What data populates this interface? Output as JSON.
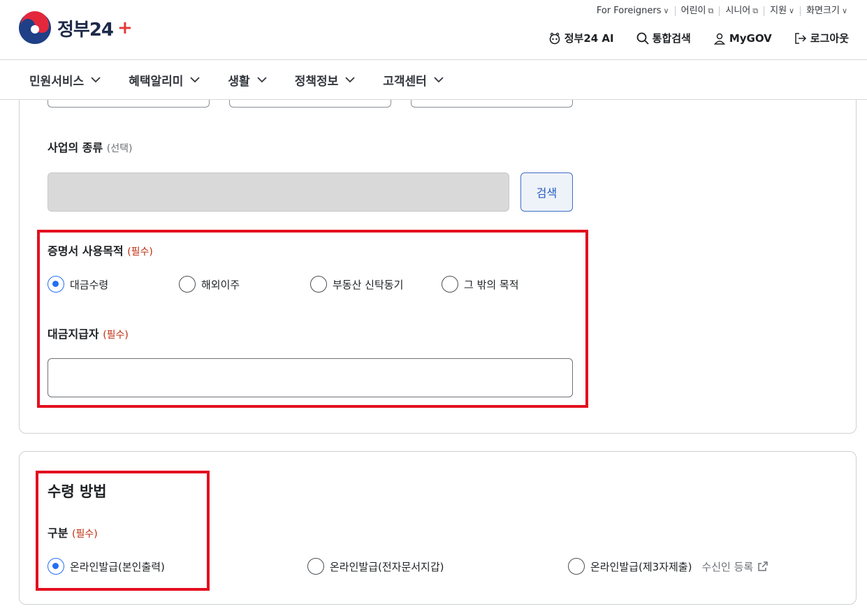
{
  "header": {
    "logo_text": "정부24",
    "logo_plus": "+",
    "util_links": [
      {
        "label": "For Foreigners",
        "glyph": "∨"
      },
      {
        "label": "어린이",
        "glyph": "⧉"
      },
      {
        "label": "시니어",
        "glyph": "⧉"
      },
      {
        "label": "지원",
        "glyph": "∨"
      },
      {
        "label": "화면크기",
        "glyph": "∨"
      }
    ],
    "main_links": [
      {
        "label": "정부24 AI",
        "icon": "ai-robot-icon"
      },
      {
        "label": "통합검색",
        "icon": "search-icon"
      },
      {
        "label": "MyGOV",
        "icon": "user-icon"
      },
      {
        "label": "로그아웃",
        "icon": "logout-icon"
      }
    ]
  },
  "gnb": {
    "items": [
      {
        "label": "민원서비스"
      },
      {
        "label": "혜택알리미"
      },
      {
        "label": "생활"
      },
      {
        "label": "정책정보"
      },
      {
        "label": "고객센터"
      }
    ]
  },
  "form": {
    "business_type": {
      "label": "사업의 종류",
      "hint": "(선택)",
      "search_button": "검색"
    },
    "purpose": {
      "label": "증명서 사용목적",
      "hint": "(필수)",
      "options": [
        "대금수령",
        "해외이주",
        "부동산 신탁동기",
        "그 밖의 목적"
      ],
      "selected": 0
    },
    "payer": {
      "label": "대금지급자",
      "hint": "(필수)",
      "value": ""
    }
  },
  "receive": {
    "title": "수령 방법",
    "category_label": "구분",
    "category_hint": "(필수)",
    "options": [
      "온라인발급(본인출력)",
      "온라인발급(전자문서지갑)",
      "온라인발급(제3자제출)"
    ],
    "selected": 0,
    "recipient_link": "수신인 등록"
  },
  "colors": {
    "accent": "#256ef4",
    "required": "#bd2c0f",
    "highlight": "#e3101f"
  }
}
